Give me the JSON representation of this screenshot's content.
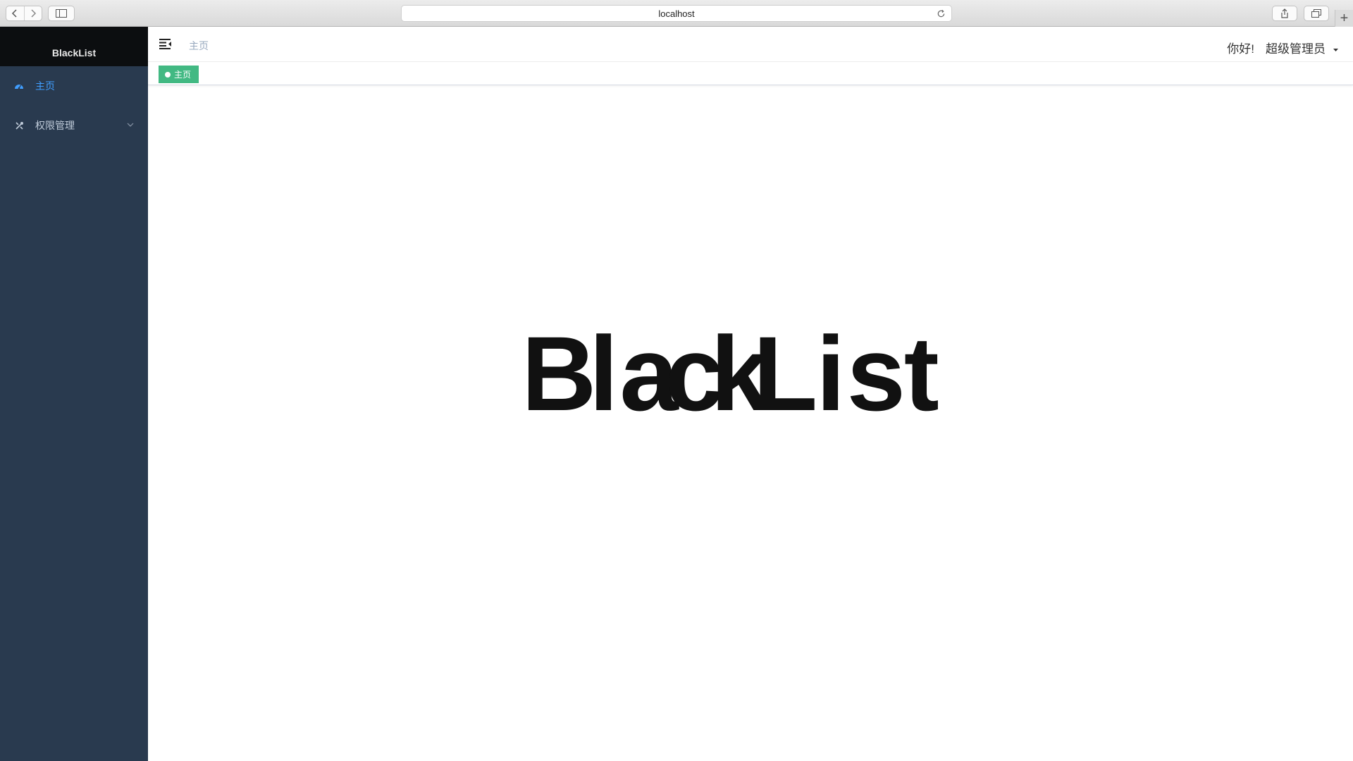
{
  "browser": {
    "url": "localhost",
    "new_tab_label": "+"
  },
  "sidebar": {
    "logo": "BlackList",
    "items": [
      {
        "label": "主页",
        "icon": "dashboard-icon",
        "active": true
      },
      {
        "label": "权限管理",
        "icon": "tools-icon",
        "active": false,
        "expandable": true
      }
    ]
  },
  "navbar": {
    "breadcrumb": "主页",
    "greeting": "你好!",
    "user_name": "超级管理员"
  },
  "tags": [
    {
      "label": "主页",
      "color": "#42b983"
    }
  ],
  "main": {
    "hero_text": "BlackList"
  },
  "colors": {
    "sidebar_bg": "#293a4f",
    "logo_bg": "#0c0e10",
    "active": "#409eff",
    "tag": "#42b983"
  }
}
